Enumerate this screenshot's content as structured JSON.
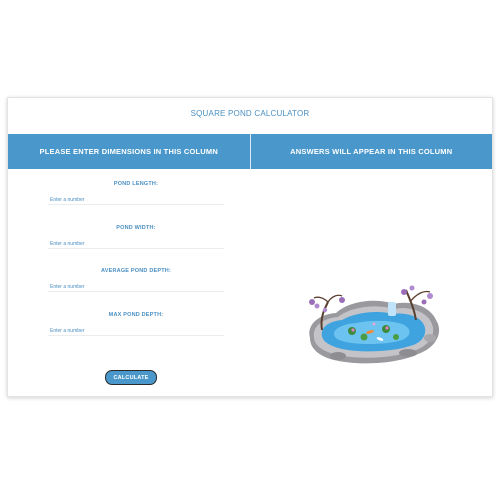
{
  "app": {
    "title": "SQUARE POND CALCULATOR"
  },
  "columns": {
    "input_header": "PLEASE ENTER DIMENSIONS IN THIS COLUMN",
    "output_header": "ANSWERS WILL APPEAR IN THIS COLUMN"
  },
  "fields": [
    {
      "label": "POND LENGTH:",
      "placeholder": "Enter a number",
      "value": ""
    },
    {
      "label": "POND WIDTH:",
      "placeholder": "Enter a number",
      "value": ""
    },
    {
      "label": "AVERAGE POND DEPTH:",
      "placeholder": "Enter a number",
      "value": ""
    },
    {
      "label": "MAX POND DEPTH:",
      "placeholder": "Enter a number",
      "value": ""
    }
  ],
  "actions": {
    "calculate_label": "CALCULATE"
  },
  "colors": {
    "accent": "#4a98cb",
    "text_accent": "#4a8fc2"
  },
  "illustration": {
    "icon": "koi-pond-illustration"
  }
}
